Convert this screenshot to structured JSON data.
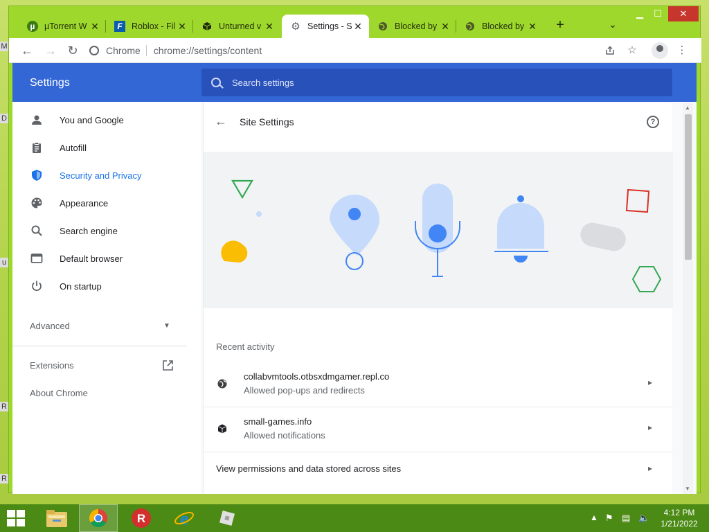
{
  "desktop": {
    "edge_letters": [
      "M",
      "D",
      "u",
      "R",
      "R"
    ]
  },
  "window": {
    "controls": {
      "minimize_icon": "minimize-icon",
      "maximize_icon": "maximize-icon",
      "close_icon": "close-icon"
    },
    "tabs": [
      {
        "title": "µTorrent W",
        "icon": "utorrent-icon"
      },
      {
        "title": "Roblox - Fil",
        "icon": "roblox-f-icon"
      },
      {
        "title": "Unturned v",
        "icon": "cube-icon"
      },
      {
        "title": "Settings - S",
        "icon": "gear-icon",
        "active": true
      },
      {
        "title": "Blocked by",
        "icon": "globe-icon"
      },
      {
        "title": "Blocked by",
        "icon": "globe-icon"
      }
    ],
    "new_tab": "+",
    "tab_search": "⌄"
  },
  "toolbar": {
    "brand": "Chrome",
    "url": "chrome://settings/content"
  },
  "settings": {
    "title": "Settings",
    "search_placeholder": "Search settings",
    "nav": [
      {
        "label": "You and Google",
        "icon": "person-icon"
      },
      {
        "label": "Autofill",
        "icon": "clipboard-icon"
      },
      {
        "label": "Security and Privacy",
        "icon": "shield-icon",
        "active": true
      },
      {
        "label": "Appearance",
        "icon": "palette-icon"
      },
      {
        "label": "Search engine",
        "icon": "search-icon"
      },
      {
        "label": "Default browser",
        "icon": "browser-window-icon"
      },
      {
        "label": "On startup",
        "icon": "power-icon"
      }
    ],
    "advanced": "Advanced",
    "extensions": "Extensions",
    "about": "About Chrome"
  },
  "site_settings": {
    "title": "Site Settings",
    "recent_heading": "Recent activity",
    "recent": [
      {
        "site": "collabvmtools.otbsxdmgamer.repl.co",
        "detail": "Allowed pop-ups and redirects",
        "icon": "globe-icon"
      },
      {
        "site": "small-games.info",
        "detail": "Allowed notifications",
        "icon": "cube-icon"
      }
    ],
    "view_all": "View permissions and data stored across sites"
  },
  "taskbar": {
    "apps": [
      "file-explorer-icon",
      "chrome-icon",
      "roblox-icon",
      "internet-explorer-icon",
      "roblox-studio-icon"
    ],
    "time": "4:12 PM",
    "date": "1/21/2022"
  },
  "colors": {
    "accent": "#3367d6",
    "link_blue": "#1a73e8",
    "taskbar": "#4b8a14",
    "frame": "#9fd82c"
  }
}
